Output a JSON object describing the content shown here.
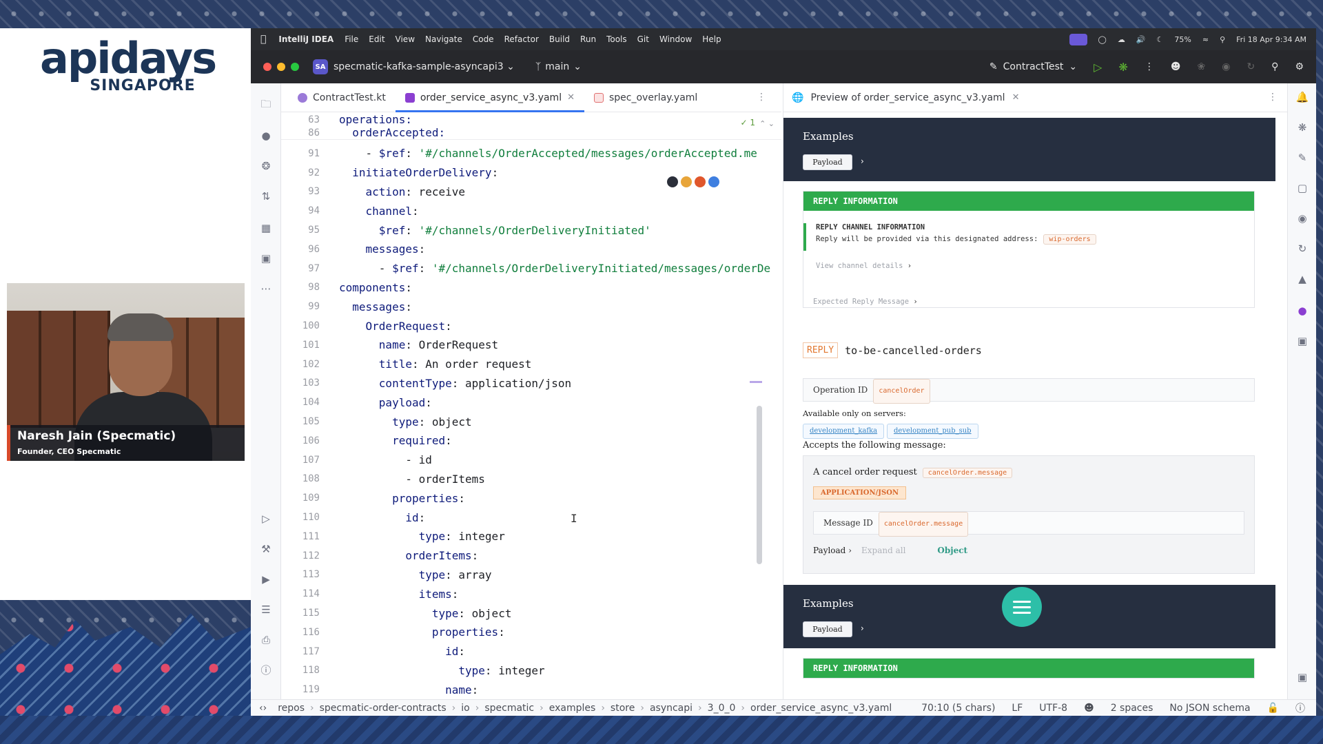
{
  "conference": {
    "logo_main": "apidays",
    "logo_sub": "SINGAPORE"
  },
  "speaker": {
    "name": "Naresh Jain (Specmatic)",
    "role": "Founder, CEO Specmatic"
  },
  "menubar": {
    "app": "IntelliJ IDEA",
    "items": [
      "File",
      "Edit",
      "View",
      "Navigate",
      "Code",
      "Refactor",
      "Build",
      "Run",
      "Tools",
      "Git",
      "Window",
      "Help"
    ],
    "battery": "75%",
    "datetime": "Fri 18 Apr 9:34 AM"
  },
  "titlebar": {
    "project_badge": "SA",
    "project": "specmatic-kafka-sample-asyncapi3",
    "branch": "main",
    "run_config": "ContractTest"
  },
  "editor": {
    "tabs": [
      {
        "label": "ContractTest.kt"
      },
      {
        "label": "order_service_async_v3.yaml"
      },
      {
        "label": "spec_overlay.yaml"
      }
    ],
    "problems_count": "1",
    "sticky": [
      {
        "n": "63",
        "text": "operations:"
      },
      {
        "n": "86",
        "text": "  orderAccepted:"
      }
    ],
    "lines": [
      {
        "n": "91",
        "text": "    - $ref: '#/channels/OrderAccepted/messages/orderAccepted.me"
      },
      {
        "n": "92",
        "text": "  initiateOrderDelivery:"
      },
      {
        "n": "93",
        "text": "    action: receive"
      },
      {
        "n": "94",
        "text": "    channel:"
      },
      {
        "n": "95",
        "text": "      $ref: '#/channels/OrderDeliveryInitiated'"
      },
      {
        "n": "96",
        "text": "    messages:"
      },
      {
        "n": "97",
        "text": "      - $ref: '#/channels/OrderDeliveryInitiated/messages/orderDe"
      },
      {
        "n": "98",
        "text": "components:"
      },
      {
        "n": "99",
        "text": "  messages:"
      },
      {
        "n": "100",
        "text": "    OrderRequest:"
      },
      {
        "n": "101",
        "text": "      name: OrderRequest"
      },
      {
        "n": "102",
        "text": "      title: An order request"
      },
      {
        "n": "103",
        "text": "      contentType: application/json"
      },
      {
        "n": "104",
        "text": "      payload:"
      },
      {
        "n": "105",
        "text": "        type: object"
      },
      {
        "n": "106",
        "text": "        required:"
      },
      {
        "n": "107",
        "text": "          - id"
      },
      {
        "n": "108",
        "text": "          - orderItems"
      },
      {
        "n": "109",
        "text": "        properties:"
      },
      {
        "n": "110",
        "text": "          id:"
      },
      {
        "n": "111",
        "text": "            type: integer"
      },
      {
        "n": "112",
        "text": "          orderItems:"
      },
      {
        "n": "113",
        "text": "            type: array"
      },
      {
        "n": "114",
        "text": "            items:"
      },
      {
        "n": "115",
        "text": "              type: object"
      },
      {
        "n": "116",
        "text": "              properties:"
      },
      {
        "n": "117",
        "text": "                id:"
      },
      {
        "n": "118",
        "text": "                  type: integer"
      },
      {
        "n": "119",
        "text": "                name:"
      }
    ]
  },
  "preview": {
    "tab": "Preview of order_service_async_v3.yaml",
    "examples_title": "Examples",
    "payload_label": "Payload",
    "reply_info_header": "REPLY INFORMATION",
    "reply_channel_title": "REPLY CHANNEL INFORMATION",
    "reply_channel_text": "Reply will be provided via this designated address:",
    "reply_channel_address": "wip-orders",
    "view_channel_details": "View channel details",
    "expected_reply": "Expected Reply Message",
    "reply_tag": "REPLY",
    "reply_name": "to-be-cancelled-orders",
    "operation_id_label": "Operation ID",
    "operation_id": "cancelOrder",
    "available_servers_label": "Available only on servers:",
    "servers": [
      "development_kafka",
      "development_pub_sub"
    ],
    "accepts_label": "Accepts the following message:",
    "message_title": "A cancel order request",
    "message_tag": "cancelOrder.message",
    "content_type": "APPLICATION/JSON",
    "message_id_label": "Message ID",
    "message_id": "cancelOrder.message",
    "payload_row_label": "Payload",
    "expand_all": "Expand all",
    "object_label": "Object"
  },
  "statusbar": {
    "breadcrumb": [
      "repos",
      "specmatic-order-contracts",
      "io",
      "specmatic",
      "examples",
      "store",
      "asyncapi",
      "3_0_0",
      "order_service_async_v3.yaml"
    ],
    "position": "70:10 (5 chars)",
    "line_sep": "LF",
    "encoding": "UTF-8",
    "indent": "2 spaces",
    "schema": "No JSON schema"
  }
}
